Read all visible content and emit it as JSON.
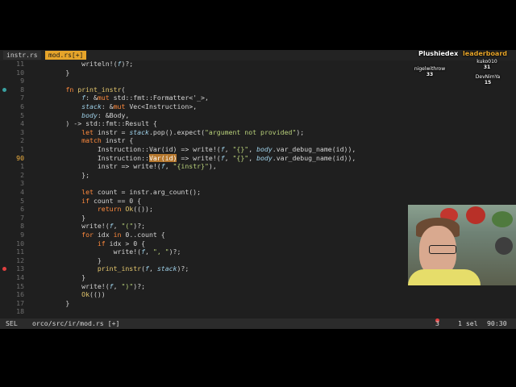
{
  "tabs": [
    {
      "label": "instr.rs",
      "active": false
    },
    {
      "label": "mod.rs[+]",
      "active": true
    }
  ],
  "lines": [
    {
      "num": "11",
      "code": "            writeln!(f)?;"
    },
    {
      "num": "10",
      "code": "        }"
    },
    {
      "num": "9",
      "code": ""
    },
    {
      "num": "8",
      "code": "        fn print_instr("
    },
    {
      "num": "7",
      "code": "            f: &mut std::fmt::Formatter<'_>,"
    },
    {
      "num": "6",
      "code": "            stack: &mut Vec<Instruction>,"
    },
    {
      "num": "5",
      "code": "            body: &Body,"
    },
    {
      "num": "4",
      "code": "        ) -> std::fmt::Result {"
    },
    {
      "num": "3",
      "code": "            let instr = stack.pop().expect(\"argument not provided\");"
    },
    {
      "num": "2",
      "code": "            match instr {"
    },
    {
      "num": "1",
      "code": "                Instruction::Var(id) => write!(f, \"{}\", body.var_debug_name(id)),"
    },
    {
      "num": "90",
      "code": "                Instruction::Var(id) => write!(f, \"{}\", body.var_debug_name(id)),",
      "current": true
    },
    {
      "num": "1",
      "code": "                instr => write!(f, \"{instr}\"),"
    },
    {
      "num": "2",
      "code": "            };"
    },
    {
      "num": "3",
      "code": ""
    },
    {
      "num": "4",
      "code": "            let count = instr.arg_count();"
    },
    {
      "num": "5",
      "code": "            if count == 0 {"
    },
    {
      "num": "6",
      "code": "                return Ok(());"
    },
    {
      "num": "7",
      "code": "            }"
    },
    {
      "num": "8",
      "code": "            write!(f, \"(\")?;"
    },
    {
      "num": "9",
      "code": "            for idx in 0..count {"
    },
    {
      "num": "10",
      "code": "                if idx > 0 {"
    },
    {
      "num": "11",
      "code": "                    write!(f, \", \")?;"
    },
    {
      "num": "12",
      "code": "                }"
    },
    {
      "num": "13",
      "code": "                print_instr(f, stack)?;"
    },
    {
      "num": "14",
      "code": "            }"
    },
    {
      "num": "15",
      "code": "            write!(f, \")\")?;"
    },
    {
      "num": "16",
      "code": "            Ok(())"
    },
    {
      "num": "17",
      "code": "        }"
    },
    {
      "num": "18",
      "code": ""
    }
  ],
  "status": {
    "mode": "SEL",
    "path": "orco/src/ir/mod.rs [+]",
    "errors": "3",
    "selections": "1 sel",
    "position": "90:30"
  },
  "leaderboard": {
    "title": "Plushiedex",
    "subtitle": "leaderboard",
    "entries": [
      {
        "name": "nigelwithrow",
        "score": "33"
      },
      {
        "name": "kuko010",
        "score": "31"
      },
      {
        "name": "DevNimYa",
        "score": "15"
      }
    ]
  },
  "colors": {
    "editor_bg": "#1f1f1f",
    "keyword": "#ff8a3d",
    "string": "#b8d07a",
    "active_tab": "#e6a42a",
    "current_line_number": "#f0b040",
    "selection": "#b5772d",
    "error": "#e04040"
  }
}
